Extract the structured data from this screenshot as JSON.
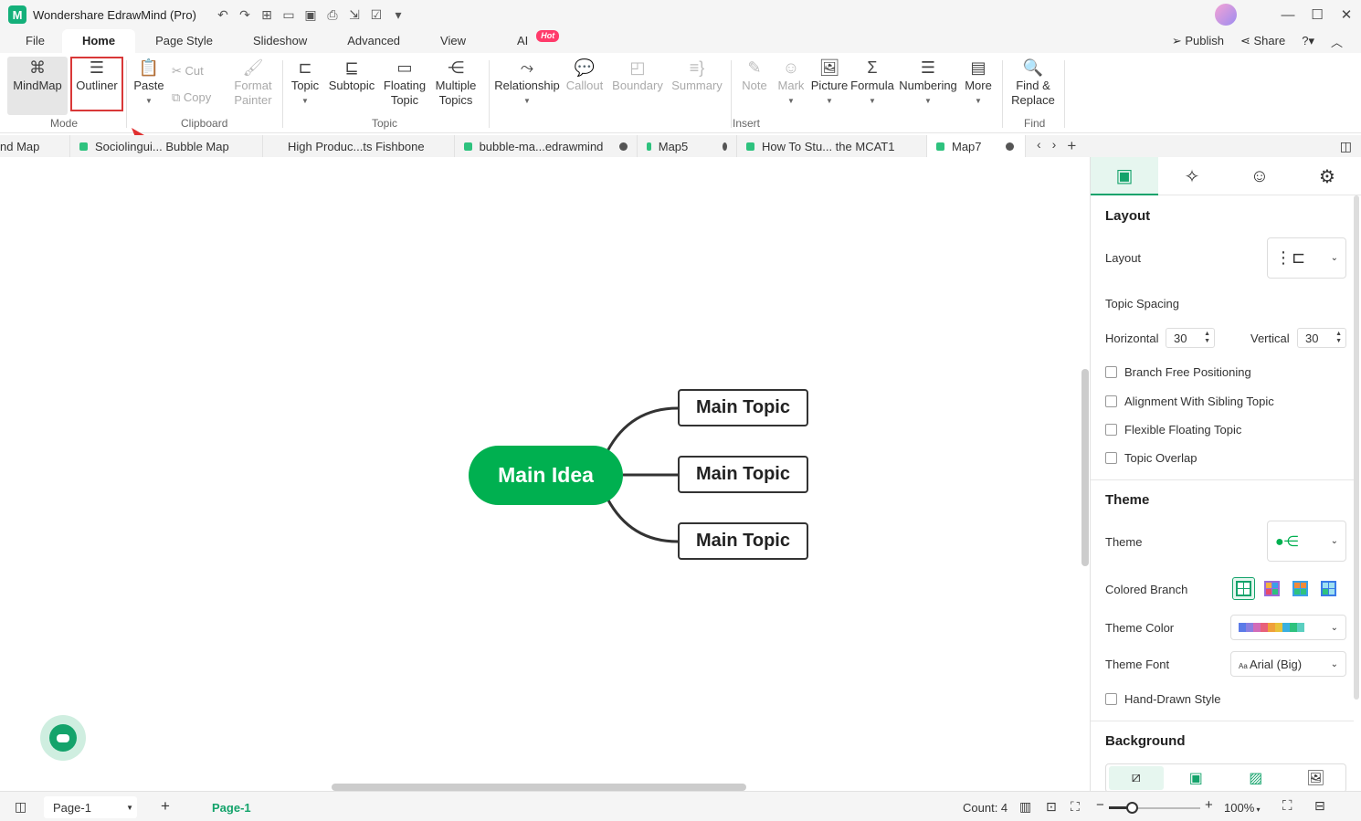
{
  "app": {
    "title": "Wondershare EdrawMind (Pro)",
    "logo_icon": "edrawmind-logo-icon"
  },
  "menubar": {
    "items": [
      "File",
      "Home",
      "Page Style",
      "Slideshow",
      "Advanced",
      "View",
      "AI"
    ],
    "active": "Home",
    "ai_badge": "Hot",
    "publish": "Publish",
    "share": "Share"
  },
  "ribbon": {
    "mindmap": "MindMap",
    "outliner": "Outliner",
    "mode_group": "Mode",
    "paste": "Paste",
    "cut": "Cut",
    "copy": "Copy",
    "format_painter_1": "Format",
    "format_painter_2": "Painter",
    "clipboard_group": "Clipboard",
    "topic": "Topic",
    "subtopic": "Subtopic",
    "floating_1": "Floating",
    "floating_2": "Topic",
    "multiple_1": "Multiple",
    "multiple_2": "Topics",
    "topic_group": "Topic",
    "relationship": "Relationship",
    "callout": "Callout",
    "boundary": "Boundary",
    "summary": "Summary",
    "note": "Note",
    "mark": "Mark",
    "picture": "Picture",
    "formula": "Formula",
    "numbering": "Numbering",
    "more": "More",
    "insert_group": "Insert",
    "find_1": "Find &",
    "find_2": "Replace",
    "find_group": "Find"
  },
  "tabs": [
    {
      "label": "nd Map",
      "modified": false,
      "icon": false
    },
    {
      "label": "Sociolingui... Bubble Map",
      "modified": false,
      "icon": true
    },
    {
      "label": "High Produc...ts Fishbone",
      "modified": false,
      "icon": false
    },
    {
      "label": "bubble-ma...edrawmind",
      "modified": true,
      "icon": true
    },
    {
      "label": "Map5",
      "modified": true,
      "icon": true
    },
    {
      "label": "How To Stu... the MCAT1",
      "modified": false,
      "icon": true
    },
    {
      "label": "Map7",
      "modified": true,
      "icon": true,
      "active": true
    }
  ],
  "canvas": {
    "main_idea": "Main Idea",
    "topics": [
      "Main Topic",
      "Main Topic",
      "Main Topic"
    ],
    "main_color": "#00b050"
  },
  "panel": {
    "layout_title": "Layout",
    "layout_label": "Layout",
    "topic_spacing": "Topic Spacing",
    "horizontal_label": "Horizontal",
    "horizontal_value": "30",
    "vertical_label": "Vertical",
    "vertical_value": "30",
    "checkboxes": [
      "Branch Free Positioning",
      "Alignment With Sibling Topic",
      "Flexible Floating Topic",
      "Topic Overlap"
    ],
    "theme_title": "Theme",
    "theme_label": "Theme",
    "colored_branch": "Colored Branch",
    "theme_color": "Theme Color",
    "theme_font": "Theme Font",
    "theme_font_value": "Arial (Big)",
    "hand_drawn": "Hand-Drawn Style",
    "background_title": "Background",
    "accent": "#14a36b"
  },
  "statusbar": {
    "page_select": "Page-1",
    "page_tab": "Page-1",
    "count": "Count: 4",
    "zoom": "100%"
  }
}
